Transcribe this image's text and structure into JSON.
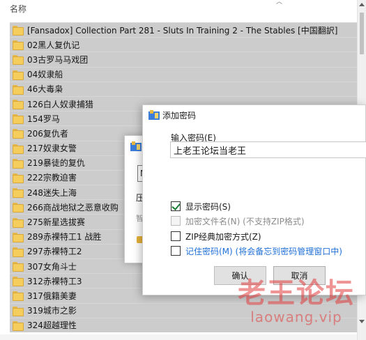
{
  "explorer": {
    "column_header": "名称",
    "items": [
      "[Fansadox] Collection Part 281 - Sluts In Training 2 - The Stables [中国翻訳]",
      "02黑人复仇记",
      "03古罗马马戏团",
      "04奴隶船",
      "46大毒枭",
      "126白人奴隶捕猎",
      "154罗马",
      "206复仇者",
      "217奴隶女警",
      "219暴徒的复仇",
      "222宗教迫害",
      "248迷失上海",
      "266商战地狱之恶意收购",
      "275新星选拔赛",
      "289赤裸特工1 战胜",
      "297赤裸特工2",
      "307女角斗士",
      "312赤裸特工3",
      "317俄籍美妻",
      "319城市之影",
      "324超越理性"
    ]
  },
  "background_dialog": {
    "input_value": "M",
    "text1": "压",
    "text2": "智"
  },
  "dialog": {
    "title": "添加密码",
    "password_label": "输入密码(E)",
    "password_value": "上老王论坛当老王",
    "options": [
      {
        "label": "显示密码(S)",
        "checked": true,
        "disabled": false
      },
      {
        "label": "加密文件名(N) (不支持ZIP格式)",
        "checked": false,
        "disabled": true
      },
      {
        "label": "ZIP经典加密方式(Z)",
        "checked": false,
        "disabled": false
      },
      {
        "label": "记住密码(M) (将会备忘到密码管理窗口中)",
        "checked": false,
        "disabled": false
      }
    ],
    "ok_label": "确认",
    "cancel_label": "取消"
  },
  "watermark": {
    "title": "老王论坛",
    "url": "laowang.vip"
  },
  "colors": {
    "selection": "#cccccc",
    "link": "#1f6fd6",
    "checkmark": "#1a7f37",
    "watermark": "#e03c3c"
  }
}
